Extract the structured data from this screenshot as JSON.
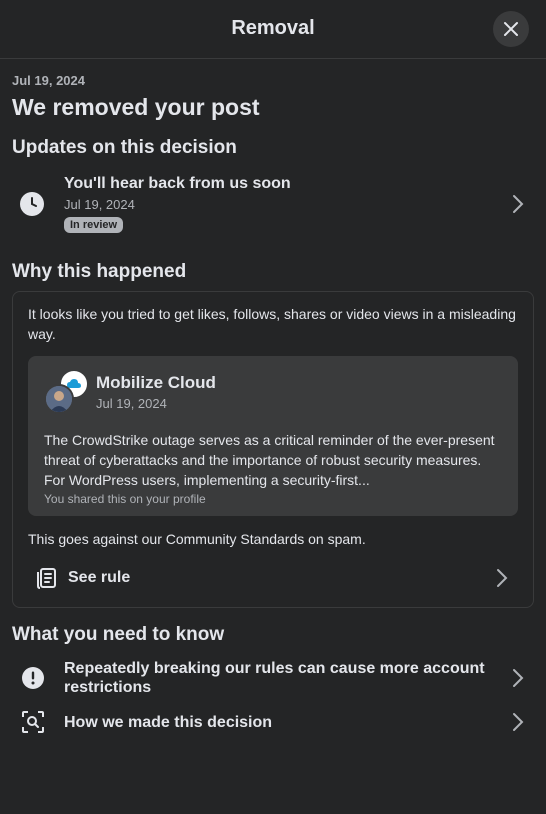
{
  "header": {
    "title": "Removal"
  },
  "top": {
    "date": "Jul 19, 2024",
    "title": "We removed your post"
  },
  "updates": {
    "title": "Updates on this decision",
    "item": {
      "title": "You'll hear back from us soon",
      "date": "Jul 19, 2024",
      "badge": "In review"
    }
  },
  "why": {
    "title": "Why this happened",
    "text": "It looks like you tried to get likes, follows, shares or video views in a misleading way.",
    "post": {
      "author": "Mobilize Cloud",
      "date": "Jul 19, 2024",
      "body": "The CrowdStrike outage serves as a critical reminder of the ever-present threat of cyberattacks and the importance of robust security measures. For WordPress users, implementing a security-first...",
      "shared": "You shared this on your profile"
    },
    "standards": "This goes against our Community Standards on spam.",
    "rule_label": "See rule"
  },
  "know": {
    "title": "What you need to know",
    "items": [
      {
        "label": "Repeatedly breaking our rules can cause more account restrictions"
      },
      {
        "label": "How we made this decision"
      }
    ]
  }
}
